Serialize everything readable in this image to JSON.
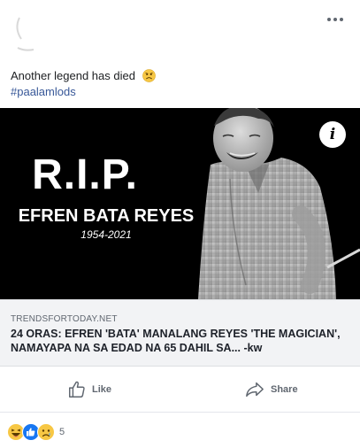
{
  "post": {
    "caption": "Another legend has died",
    "hashtag": "#paalamlods",
    "image": {
      "title": "R.I.P.",
      "name": "EFREN BATA REYES",
      "years": "1954-2021",
      "info_label": "i"
    },
    "link": {
      "domain": "TRENDSFORTODAY.NET",
      "title": "24 ORAS: EFREN 'BATA' MANALANG REYES 'THE MAGICIAN', NAMAYAPA NA SA EDAD NA 65 DAHIL SA... -kw"
    },
    "actions": {
      "like_label": "Like",
      "share_label": "Share"
    },
    "reactions": {
      "icons": [
        "haha-icon",
        "like-icon",
        "sad-icon"
      ],
      "count": "5"
    }
  },
  "colors": {
    "link_blue": "#385898",
    "meta_gray": "#606770",
    "link_bg": "#f2f3f5",
    "image_bg": "#000000"
  }
}
